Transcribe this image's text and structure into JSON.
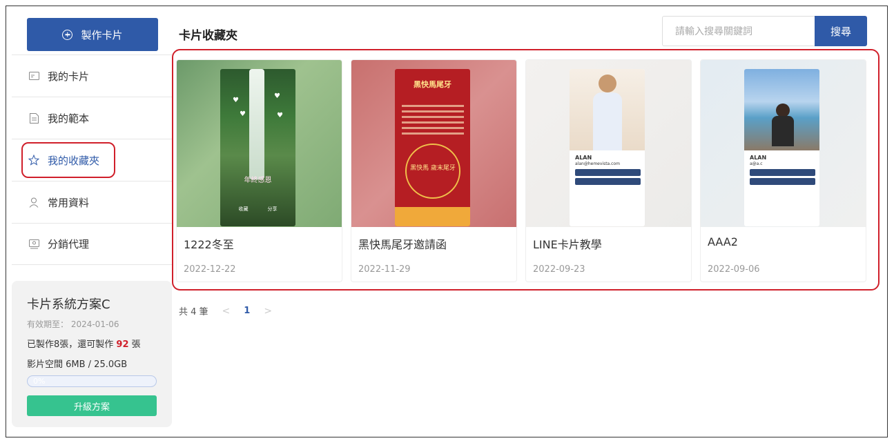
{
  "sidebar": {
    "make_button": "製作卡片",
    "nav": [
      {
        "label": "我的卡片",
        "icon": "card-icon"
      },
      {
        "label": "我的範本",
        "icon": "document-icon"
      },
      {
        "label": "我的收藏夾",
        "icon": "star-icon",
        "active": true
      },
      {
        "label": "常用資料",
        "icon": "user-icon"
      },
      {
        "label": "分銷代理",
        "icon": "agent-icon"
      }
    ],
    "plan": {
      "title": "卡片系統方案C",
      "valid_until": "有效期至：  2024-01-06",
      "made_prefix": "已製作8張，還可製作 ",
      "made_remaining": "92",
      "made_suffix": " 張",
      "space": "影片空間 6MB / 25.0GB",
      "progress": 0,
      "progress_label": "0%",
      "upgrade": "升級方案"
    }
  },
  "main": {
    "title": "卡片收藏夾",
    "search": {
      "placeholder": "請輸入搜尋關鍵詞",
      "button": "搜尋"
    },
    "cards": [
      {
        "name": "1222冬至",
        "date": "2022-12-22",
        "thumb_text": "年終感恩",
        "actions": [
          "收藏",
          "分享"
        ]
      },
      {
        "name": "黑快馬尾牙邀請函",
        "date": "2022-11-29",
        "thumb_text": "黑快馬尾牙",
        "ring_text": "黑快馬 歲末尾牙"
      },
      {
        "name": "LINE卡片教學",
        "date": "2022-09-23",
        "card_name": "ALAN",
        "email": "alan@hemevista.com",
        "buttons": [
          "分享給好友",
          "存儲聯絡人"
        ]
      },
      {
        "name": "AAA2",
        "date": "2022-09-06",
        "card_name": "ALAN",
        "email": "a@a.c",
        "buttons": [
          "分享給好友",
          "存儲聯絡人"
        ]
      }
    ],
    "pagination": {
      "total": "共 4 筆",
      "prev": "<",
      "page": "1",
      "next": ">"
    }
  },
  "colors": {
    "primary": "#2f5aa8",
    "highlight": "#d01f2a",
    "success": "#36c38f"
  }
}
